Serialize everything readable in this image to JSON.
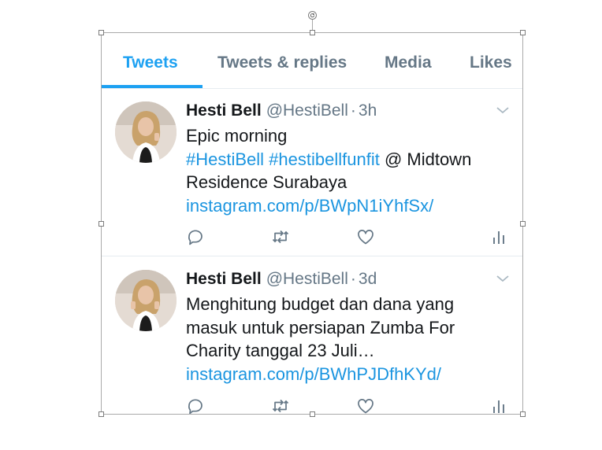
{
  "tabs": [
    {
      "label": "Tweets",
      "active": true
    },
    {
      "label": "Tweets & replies",
      "active": false
    },
    {
      "label": "Media",
      "active": false
    },
    {
      "label": "Likes",
      "active": false
    }
  ],
  "tweets": [
    {
      "name": "Hesti Bell",
      "handle": "@HestiBell",
      "separator": "·",
      "time": "3h",
      "line1": "Epic morning",
      "hashtag1": "#HestiBell",
      "hashtag2": "#hestibellfunfit",
      "mention_text": " @ Midtown Residence Surabaya ",
      "link": "instagram.com/p/BWpN1iYhfSx/"
    },
    {
      "name": "Hesti Bell",
      "handle": "@HestiBell",
      "separator": "·",
      "time": "3d",
      "body": "Menghitung budget dan dana yang masuk untuk persiapan Zumba For Charity tanggal 23 Juli…",
      "link": "instagram.com/p/BWhPJDfhKYd/"
    }
  ],
  "icons": {
    "reply": "reply-icon",
    "retweet": "retweet-icon",
    "like": "heart-icon",
    "analytics": "analytics-icon",
    "caret": "chevron-down-icon"
  },
  "colors": {
    "accent": "#1da1f2",
    "link": "#1b95e0",
    "secondary": "#657786",
    "icon": "#657786"
  }
}
